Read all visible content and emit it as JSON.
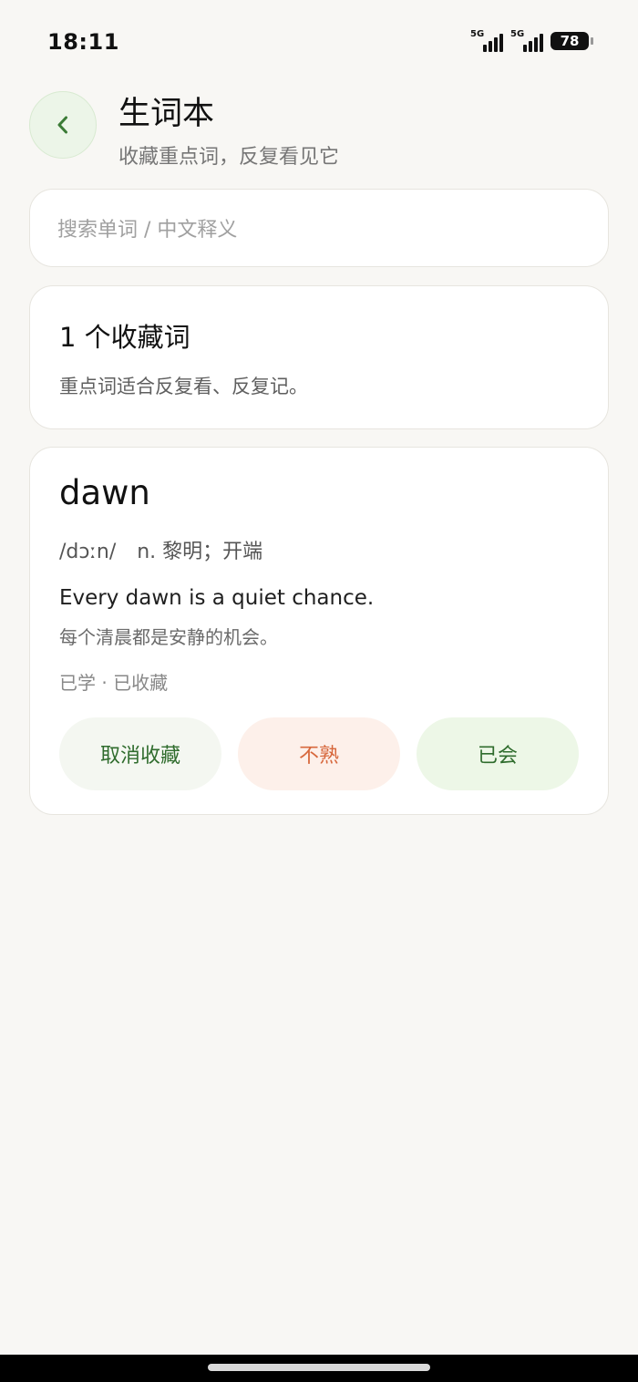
{
  "status_bar": {
    "time": "18:11",
    "signal_1": "5G",
    "signal_2": "5G",
    "battery": "78"
  },
  "header": {
    "title": "生词本",
    "subtitle": "收藏重点词，反复看见它"
  },
  "search": {
    "placeholder": "搜索单词 / 中文释义",
    "value": ""
  },
  "summary": {
    "title": "1 个收藏词",
    "description": "重点词适合反复看、反复记。"
  },
  "word_card": {
    "word": "dawn",
    "phonetic": "/dɔːn/",
    "meaning": "n. 黎明；开端",
    "example_en": "Every dawn is a quiet chance.",
    "example_zh": "每个清晨都是安静的机会。",
    "status": "已学 · 已收藏",
    "buttons": {
      "uncollect": "取消收藏",
      "unfamiliar": "不熟",
      "known": "已会"
    }
  },
  "colors": {
    "accent_green": "#2f6c2d",
    "accent_orange": "#d7683d",
    "background": "#f8f7f4"
  },
  "icons": {
    "back": "chevron-left-icon"
  }
}
